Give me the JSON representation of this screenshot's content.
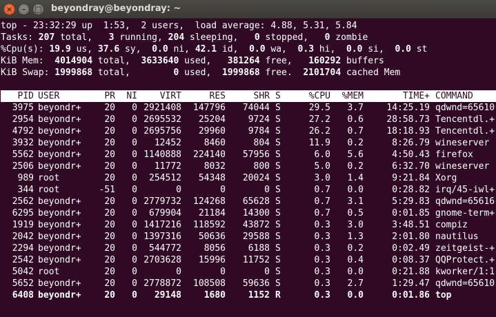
{
  "window": {
    "title": "beyondray@beyondray: ~",
    "close_glyph": "×",
    "minimize_glyph": "–",
    "maximize_glyph": "□"
  },
  "summary": {
    "line1": "top - 23:32:29 up  1:53,  2 users,  load average: 4.88, 5.31, 5.84",
    "tasks": {
      "label": "Tasks: ",
      "total": "207",
      "total_label": " total,   ",
      "running": "3",
      "running_label": " running, ",
      "sleeping": "204",
      "sleeping_label": " sleeping,   ",
      "stopped": "0",
      "stopped_label": " stopped,   ",
      "zombie": "0",
      "zombie_label": " zombie"
    },
    "cpu": {
      "label": "%Cpu(s): ",
      "us": "19.9",
      "us_label": " us, ",
      "sy": "37.6",
      "sy_label": " sy,  ",
      "ni": "0.0",
      "ni_label": " ni, ",
      "id": "42.1",
      "id_label": " id,  ",
      "wa": "0.0",
      "wa_label": " wa,  ",
      "hi": "0.3",
      "hi_label": " hi,  ",
      "si": "0.0",
      "si_label": " si,  ",
      "st": "0.0",
      "st_label": " st"
    },
    "mem": {
      "label": "KiB Mem:  ",
      "total": "4014904",
      "total_label": " total,  ",
      "used": "3633640",
      "used_label": " used,   ",
      "free": "381264",
      "free_label": " free,   ",
      "buffers": "160292",
      "buffers_label": " buffers"
    },
    "swap": {
      "label": "KiB Swap: ",
      "total": "1999868",
      "total_label": " total,        ",
      "used": "0",
      "used_label": " used,  ",
      "free": "1999868",
      "free_label": " free.  ",
      "cached": "2101704",
      "cached_label": " cached Mem"
    }
  },
  "columns": {
    "pid": "PID",
    "user": "USER",
    "pr": "PR",
    "ni": "NI",
    "virt": "VIRT",
    "res": "RES",
    "shr": "SHR",
    "s": "S",
    "cpu": "%CPU",
    "mem": "%MEM",
    "time": "TIME+",
    "command": "COMMAND"
  },
  "processes": [
    {
      "pid": "3975",
      "user": "beyondr+",
      "pr": "20",
      "ni": "0",
      "virt": "2921408",
      "res": "147796",
      "shr": "74044",
      "s": "S",
      "cpu": "29.5",
      "mem": "3.7",
      "time": "14:25.19",
      "command": "qdwnd=65610"
    },
    {
      "pid": "2954",
      "user": "beyondr+",
      "pr": "20",
      "ni": "0",
      "virt": "2695532",
      "res": "25204",
      "shr": "9724",
      "s": "S",
      "cpu": "27.2",
      "mem": "0.6",
      "time": "28:58.73",
      "command": "Tencentdl.+"
    },
    {
      "pid": "4792",
      "user": "beyondr+",
      "pr": "20",
      "ni": "0",
      "virt": "2695756",
      "res": "29960",
      "shr": "9784",
      "s": "S",
      "cpu": "26.2",
      "mem": "0.7",
      "time": "18:18.93",
      "command": "Tencentdl.+"
    },
    {
      "pid": "3932",
      "user": "beyondr+",
      "pr": "20",
      "ni": "0",
      "virt": "12452",
      "res": "8460",
      "shr": "804",
      "s": "S",
      "cpu": "11.9",
      "mem": "0.2",
      "time": "8:26.79",
      "command": "wineserver"
    },
    {
      "pid": "5562",
      "user": "beyondr+",
      "pr": "20",
      "ni": "0",
      "virt": "1140888",
      "res": "224140",
      "shr": "57956",
      "s": "S",
      "cpu": "6.0",
      "mem": "5.6",
      "time": "4:50.43",
      "command": "firefox"
    },
    {
      "pid": "2506",
      "user": "beyondr+",
      "pr": "20",
      "ni": "0",
      "virt": "11772",
      "res": "8032",
      "shr": "800",
      "s": "S",
      "cpu": "5.0",
      "mem": "0.2",
      "time": "6:32.70",
      "command": "wineserver"
    },
    {
      "pid": "989",
      "user": "root",
      "pr": "20",
      "ni": "0",
      "virt": "254512",
      "res": "54348",
      "shr": "20024",
      "s": "S",
      "cpu": "3.0",
      "mem": "1.4",
      "time": "9:21.84",
      "command": "Xorg"
    },
    {
      "pid": "344",
      "user": "root",
      "pr": "-51",
      "ni": "0",
      "virt": "0",
      "res": "0",
      "shr": "0",
      "s": "S",
      "cpu": "0.7",
      "mem": "0.0",
      "time": "0:28.82",
      "command": "irq/45-iwl+"
    },
    {
      "pid": "2562",
      "user": "beyondr+",
      "pr": "20",
      "ni": "0",
      "virt": "2779732",
      "res": "124268",
      "shr": "65628",
      "s": "S",
      "cpu": "0.7",
      "mem": "3.1",
      "time": "5:29.83",
      "command": "qdwnd=65616"
    },
    {
      "pid": "6295",
      "user": "beyondr+",
      "pr": "20",
      "ni": "0",
      "virt": "679904",
      "res": "21184",
      "shr": "14300",
      "s": "S",
      "cpu": "0.7",
      "mem": "0.5",
      "time": "0:01.85",
      "command": "gnome-term+"
    },
    {
      "pid": "1919",
      "user": "beyondr+",
      "pr": "20",
      "ni": "0",
      "virt": "1417216",
      "res": "118592",
      "shr": "43872",
      "s": "S",
      "cpu": "0.3",
      "mem": "3.0",
      "time": "3:48.51",
      "command": "compiz"
    },
    {
      "pid": "2042",
      "user": "beyondr+",
      "pr": "20",
      "ni": "0",
      "virt": "1397316",
      "res": "50636",
      "shr": "29588",
      "s": "S",
      "cpu": "0.3",
      "mem": "1.3",
      "time": "2:01.80",
      "command": "nautilus"
    },
    {
      "pid": "2294",
      "user": "beyondr+",
      "pr": "20",
      "ni": "0",
      "virt": "544772",
      "res": "8056",
      "shr": "6188",
      "s": "S",
      "cpu": "0.3",
      "mem": "0.2",
      "time": "0:02.49",
      "command": "zeitgeist-+"
    },
    {
      "pid": "2542",
      "user": "beyondr+",
      "pr": "20",
      "ni": "0",
      "virt": "2703628",
      "res": "15996",
      "shr": "11752",
      "s": "S",
      "cpu": "0.3",
      "mem": "0.4",
      "time": "0:08.37",
      "command": "QQProtect.+"
    },
    {
      "pid": "5042",
      "user": "root",
      "pr": "20",
      "ni": "0",
      "virt": "0",
      "res": "0",
      "shr": "0",
      "s": "S",
      "cpu": "0.3",
      "mem": "0.0",
      "time": "0:21.88",
      "command": "kworker/1:1"
    },
    {
      "pid": "5652",
      "user": "beyondr+",
      "pr": "20",
      "ni": "0",
      "virt": "2778872",
      "res": "108508",
      "shr": "59636",
      "s": "S",
      "cpu": "0.3",
      "mem": "2.7",
      "time": "1:29.47",
      "command": "qdwnd=65610"
    },
    {
      "pid": "6408",
      "user": "beyondr+",
      "pr": "20",
      "ni": "0",
      "virt": "29148",
      "res": "1680",
      "shr": "1152",
      "s": "R",
      "cpu": "0.3",
      "mem": "0.0",
      "time": "0:01.86",
      "command": "top",
      "highlight": true
    }
  ]
}
